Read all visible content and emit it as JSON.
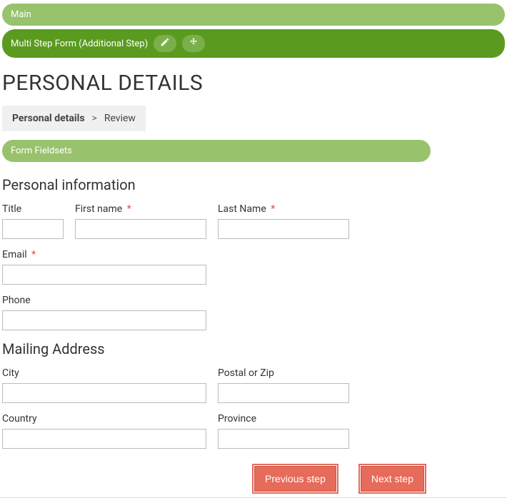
{
  "topBars": {
    "main": "Main",
    "multiStep": "Multi Step Form (Additional Step)"
  },
  "page": {
    "title": "PERSONAL DETAILS"
  },
  "breadcrumb": {
    "active": "Personal details",
    "sep": ">",
    "next": "Review"
  },
  "fieldsetsBar": "Form Fieldsets",
  "sections": {
    "personalInfo": {
      "heading": "Personal information",
      "fields": {
        "title": {
          "label": "Title",
          "value": ""
        },
        "firstName": {
          "label": "First name",
          "value": ""
        },
        "lastName": {
          "label": "Last Name",
          "value": ""
        },
        "email": {
          "label": "Email",
          "value": ""
        },
        "phone": {
          "label": "Phone",
          "value": ""
        }
      }
    },
    "mailing": {
      "heading": "Mailing Address",
      "fields": {
        "city": {
          "label": "City",
          "value": ""
        },
        "postal": {
          "label": "Postal or Zip",
          "value": ""
        },
        "country": {
          "label": "Country",
          "value": ""
        },
        "province": {
          "label": "Province",
          "value": ""
        }
      }
    }
  },
  "buttons": {
    "previous": "Previous step",
    "next": "Next step"
  },
  "requiredMarker": "*"
}
